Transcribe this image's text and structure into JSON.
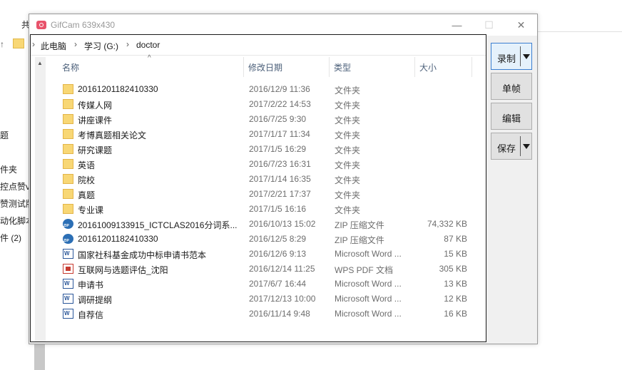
{
  "background": {
    "tab_text": "共",
    "nav_items": [
      "题",
      "件夹",
      "控点赞vi",
      "赞测试版:",
      "动化脚本",
      "件 (2)"
    ]
  },
  "gifcam": {
    "title": "GifCam 639x430",
    "controls": {
      "minimize": "—",
      "maximize": "☐",
      "close": "✕"
    },
    "side_buttons": {
      "record": "录制",
      "single_frame": "单帧",
      "edit": "编辑",
      "save": "保存"
    }
  },
  "explorer": {
    "breadcrumb": [
      "此电脑",
      "学习 (G:)",
      "doctor"
    ],
    "columns": {
      "name": "名称",
      "modified": "修改日期",
      "type": "类型",
      "size": "大小"
    },
    "files": [
      {
        "icon": "folder",
        "name": "20161201182410330",
        "date": "2016/12/9 11:36",
        "type": "文件夹",
        "size": ""
      },
      {
        "icon": "folder",
        "name": "传媒人网",
        "date": "2017/2/22 14:53",
        "type": "文件夹",
        "size": ""
      },
      {
        "icon": "folder",
        "name": "讲座课件",
        "date": "2016/7/25 9:30",
        "type": "文件夹",
        "size": ""
      },
      {
        "icon": "folder",
        "name": "考博真题相关论文",
        "date": "2017/1/17 11:34",
        "type": "文件夹",
        "size": ""
      },
      {
        "icon": "folder",
        "name": "研究课题",
        "date": "2017/1/5 16:29",
        "type": "文件夹",
        "size": ""
      },
      {
        "icon": "folder",
        "name": "英语",
        "date": "2016/7/23 16:31",
        "type": "文件夹",
        "size": ""
      },
      {
        "icon": "folder",
        "name": "院校",
        "date": "2017/1/14 16:35",
        "type": "文件夹",
        "size": ""
      },
      {
        "icon": "folder",
        "name": "真题",
        "date": "2017/2/21 17:37",
        "type": "文件夹",
        "size": ""
      },
      {
        "icon": "folder",
        "name": "专业课",
        "date": "2017/1/5 16:16",
        "type": "文件夹",
        "size": ""
      },
      {
        "icon": "zip",
        "name": "20161009133915_ICTCLAS2016分词系...",
        "date": "2016/10/13 15:02",
        "type": "ZIP 压缩文件",
        "size": "74,332 KB"
      },
      {
        "icon": "zip",
        "name": "20161201182410330",
        "date": "2016/12/5 8:29",
        "type": "ZIP 压缩文件",
        "size": "87 KB"
      },
      {
        "icon": "word",
        "name": "国家社科基金成功中标申请书范本",
        "date": "2016/12/6 9:13",
        "type": "Microsoft Word ...",
        "size": "15 KB"
      },
      {
        "icon": "pdf",
        "name": "互联网与选题评估_沈阳",
        "date": "2016/12/14 11:25",
        "type": "WPS PDF 文档",
        "size": "305 KB"
      },
      {
        "icon": "word",
        "name": "申请书",
        "date": "2017/6/7 16:44",
        "type": "Microsoft Word ...",
        "size": "13 KB"
      },
      {
        "icon": "word",
        "name": "调研提纲",
        "date": "2017/12/13 10:00",
        "type": "Microsoft Word ...",
        "size": "12 KB"
      },
      {
        "icon": "word",
        "name": "自荐信",
        "date": "2016/11/14 9:48",
        "type": "Microsoft Word ...",
        "size": "16 KB"
      }
    ]
  }
}
